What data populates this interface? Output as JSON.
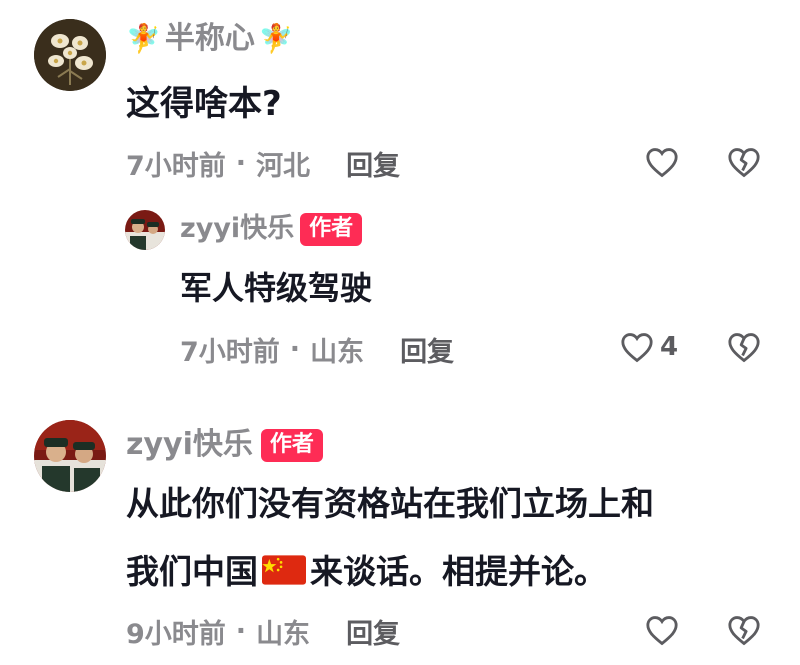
{
  "comments": [
    {
      "username": "半称心",
      "name_emoji": "🧚",
      "text": "这得啥本?",
      "time": "7小时前",
      "location": "河北",
      "reply_label": "回复",
      "like_count": ""
    },
    {
      "username": "zyyi快乐",
      "author_badge": "作者",
      "text": "军人特级驾驶",
      "time": "7小时前",
      "location": "山东",
      "reply_label": "回复",
      "like_count": "4"
    },
    {
      "username": "zyyi快乐",
      "author_badge": "作者",
      "text_line1": "从此你们没有资格站在我们立场上和",
      "text_line2_before": "我们中国",
      "text_line2_after": "来谈话。相提并论。",
      "time": "9小时前",
      "location": "山东",
      "reply_label": "回复",
      "like_count": ""
    }
  ],
  "meta_separator": "·",
  "colors": {
    "badge": "#fe2c55",
    "meta": "#8a8a8e",
    "text": "#161823"
  },
  "icons": [
    "heart-outline-icon",
    "broken-heart-icon",
    "china-flag-icon",
    "fairy-icon"
  ]
}
